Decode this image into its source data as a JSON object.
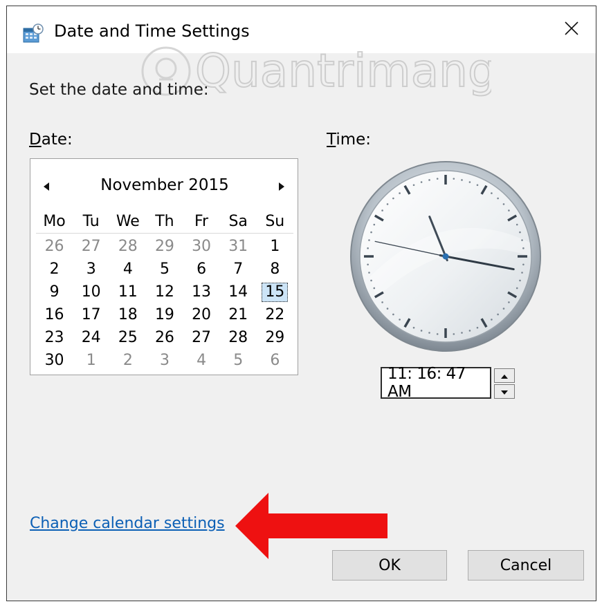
{
  "window": {
    "title": "Date and Time Settings",
    "title_icon": "date-time-settings-icon",
    "close_icon": "close-icon"
  },
  "watermark": "Quantrimang",
  "instruction": "Set the date and time:",
  "date_label": {
    "mnemonic": "D",
    "rest": "ate:"
  },
  "time_label": {
    "mnemonic": "T",
    "rest": "ime:"
  },
  "calendar": {
    "month_year": "November 2015",
    "prev_icon": "triangle-left-icon",
    "next_icon": "triangle-right-icon",
    "weekdays": [
      "Mo",
      "Tu",
      "We",
      "Th",
      "Fr",
      "Sa",
      "Su"
    ],
    "weeks": [
      [
        "26",
        "27",
        "28",
        "29",
        "30",
        "31",
        "1"
      ],
      [
        "2",
        "3",
        "4",
        "5",
        "6",
        "7",
        "8"
      ],
      [
        "9",
        "10",
        "11",
        "12",
        "13",
        "14",
        "15"
      ],
      [
        "16",
        "17",
        "18",
        "19",
        "20",
        "21",
        "22"
      ],
      [
        "23",
        "24",
        "25",
        "26",
        "27",
        "28",
        "29"
      ],
      [
        "30",
        "1",
        "2",
        "3",
        "4",
        "5",
        "6"
      ]
    ],
    "selected_day": "15"
  },
  "clock": {
    "hour": 11,
    "minute": 16,
    "second": 47
  },
  "time_value": "11: 16: 47 AM",
  "spinner": {
    "up_icon": "spin-up-icon",
    "down_icon": "spin-down-icon"
  },
  "change_calendar_link": "Change calendar settings",
  "buttons": {
    "ok": "OK",
    "cancel": "Cancel"
  },
  "colors": {
    "link": "#0b5fb5",
    "arrow": "#ee1111",
    "selected_bg": "#cce4f7",
    "dialog_bg": "#f0f0f0"
  }
}
